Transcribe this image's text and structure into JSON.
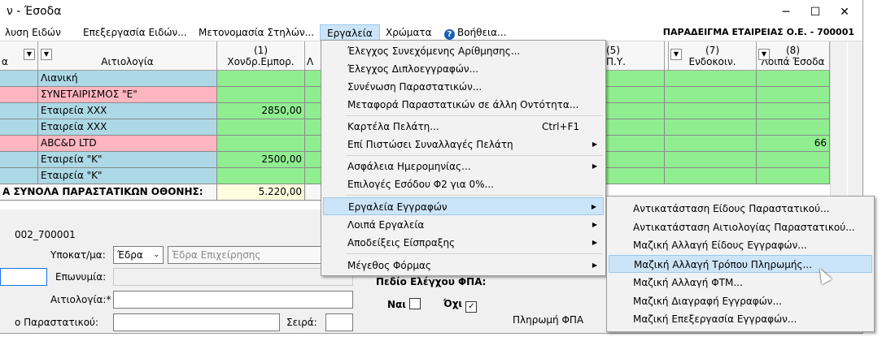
{
  "window": {
    "title": "ν - Έσοδα",
    "minimize": "─",
    "maximize": "☐",
    "close": "✕"
  },
  "menubar": {
    "items": [
      "λυση Ειδών",
      "Επεξεργασία Ειδών...",
      "Μετονομασία Στηλών...",
      "Εργαλεία",
      "Χρώματα",
      "Βοήθεια..."
    ],
    "company": "ΠΑΡΑΔΕΙΓΜΑ ΕΤΑΙΡΕΙΑΣ Ο.Ε. - 700001"
  },
  "grid": {
    "headers": {
      "col0": "α",
      "col1": "Αιτιολογία",
      "col2_num": "(1)",
      "col2": "Χονδρ.Εμπορ.",
      "col3": "Λ",
      "col5_num": "(5)",
      "col5": "Π.Υ.",
      "col7_num": "(7)",
      "col7": "Ενδοκοιν.",
      "col8_num": "(8)",
      "col8": "Λοιπά Έσοδα"
    },
    "rows": [
      {
        "reason": "Λιανική",
        "amount": "",
        "extra": "",
        "color": "blue"
      },
      {
        "reason": "ΣΥΝΕΤΑΙΡΙΣΜΟΣ \"Ε\"",
        "amount": "",
        "extra": "",
        "color": "pink"
      },
      {
        "reason": "Εταιρεία XXX",
        "amount": "2850,00",
        "extra": "",
        "color": "blue"
      },
      {
        "reason": "Εταιρεία XXX",
        "amount": "",
        "extra": "",
        "color": "blue"
      },
      {
        "reason": "ABC&D LTD",
        "amount": "",
        "extra": "66",
        "color": "pink"
      },
      {
        "reason": "Εταιρεία \"Κ\"",
        "amount": "2500,00",
        "extra": "",
        "color": "blue"
      },
      {
        "reason": "Εταιρεία \"Κ\"",
        "amount": "",
        "extra": "",
        "color": "blue"
      }
    ],
    "totals_label": "Α ΣΥΝΟΛΑ ΠΑΡΑΣΤΑΤΙΚΩΝ ΟΘΟΝΗΣ:",
    "totals_value": "5.220,00"
  },
  "form": {
    "code": "002_700001",
    "subunit_label": "Υποκατ/μα:",
    "subunit_value": "Έδρα",
    "subunit_desc": "Έδρα Επιχείρησης",
    "name_label": "Επωνυμία:",
    "reason_label": "Αιτιολογία:*",
    "doc_label": "ο Παραστατικού:",
    "series_label": "Σειρά:",
    "control_label": "Πεδίο Ελέγχου ΦΠΑ:",
    "yes_label": "Ναι",
    "no_label": "Όχι",
    "vat_payment": "Πληρωμή ΦΠΑ"
  },
  "tools_menu": {
    "items": [
      {
        "label": "Έλεγχος Συνεχόμενης Αρίθμησης...",
        "shortcut": "",
        "sub": false
      },
      {
        "label": "Έλεγχος Διπλοεγγραφών...",
        "shortcut": "",
        "sub": false
      },
      {
        "label": "Συνένωση Παραστατικών...",
        "shortcut": "",
        "sub": false
      },
      {
        "label": "Μεταφορά Παραστατικών σε άλλη Οντότητα...",
        "shortcut": "",
        "sub": false
      },
      {
        "label": "Καρτέλα Πελάτη...",
        "shortcut": "Ctrl+F1",
        "sub": false
      },
      {
        "label": "Επί Πιστώσει Συναλλαγές Πελάτη",
        "shortcut": "",
        "sub": true
      },
      {
        "label": "Ασφάλεια Ημερομηνίας...",
        "shortcut": "",
        "sub": true
      },
      {
        "label": "Επιλογές Εσόδου Φ2 για 0%...",
        "shortcut": "",
        "sub": false
      },
      {
        "label": "Εργαλεία Εγγραφών",
        "shortcut": "",
        "sub": true
      },
      {
        "label": "Λοιπά Εργαλεία",
        "shortcut": "",
        "sub": true
      },
      {
        "label": "Αποδείξεις Είσπραξης",
        "shortcut": "",
        "sub": true
      },
      {
        "label": "Μέγεθος Φόρμας",
        "shortcut": "",
        "sub": true
      }
    ]
  },
  "records_submenu": {
    "items": [
      "Αντικατάσταση Είδους Παραστατικού...",
      "Αντικατάσταση Αιτιολογίας Παραστατικού...",
      "Μαζική Αλλαγή Είδους Εγγραφών...",
      "Μαζική Αλλαγή Τρόπου Πληρωμής...",
      "Μαζική Αλλαγή ΦΤΜ...",
      "Μαζική Διαγραφή Εγγραφών...",
      "Μαζική Επεξεργασία Εγγραφών..."
    ]
  },
  "colors": {
    "blue_row": "#add8e6",
    "pink_row": "#ffb6c1",
    "green_cell": "#90ee90",
    "highlight": "#cce4f7"
  }
}
